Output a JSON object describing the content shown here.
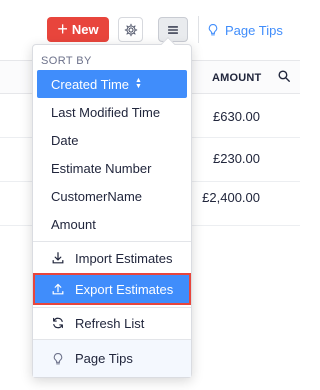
{
  "toolbar": {
    "new_label": "New",
    "page_tips_label": "Page Tips"
  },
  "table": {
    "header_amount": "AMOUNT",
    "rows": [
      {
        "amount": "£630.00"
      },
      {
        "amount": "£230.00"
      },
      {
        "amount": "£2,400.00"
      }
    ]
  },
  "dropdown": {
    "sort_by_label": "SORT BY",
    "sort_options": [
      {
        "label": "Created Time",
        "selected": true
      },
      {
        "label": "Last Modified Time"
      },
      {
        "label": "Date"
      },
      {
        "label": "Estimate Number"
      },
      {
        "label": "CustomerName"
      },
      {
        "label": "Amount"
      }
    ],
    "actions": {
      "import": "Import Estimates",
      "export": "Export Estimates",
      "refresh": "Refresh List",
      "page_tips": "Page Tips"
    }
  },
  "colors": {
    "accent_blue": "#408dfb",
    "new_button_red": "#e8453c",
    "highlight_border": "#e8453c"
  }
}
